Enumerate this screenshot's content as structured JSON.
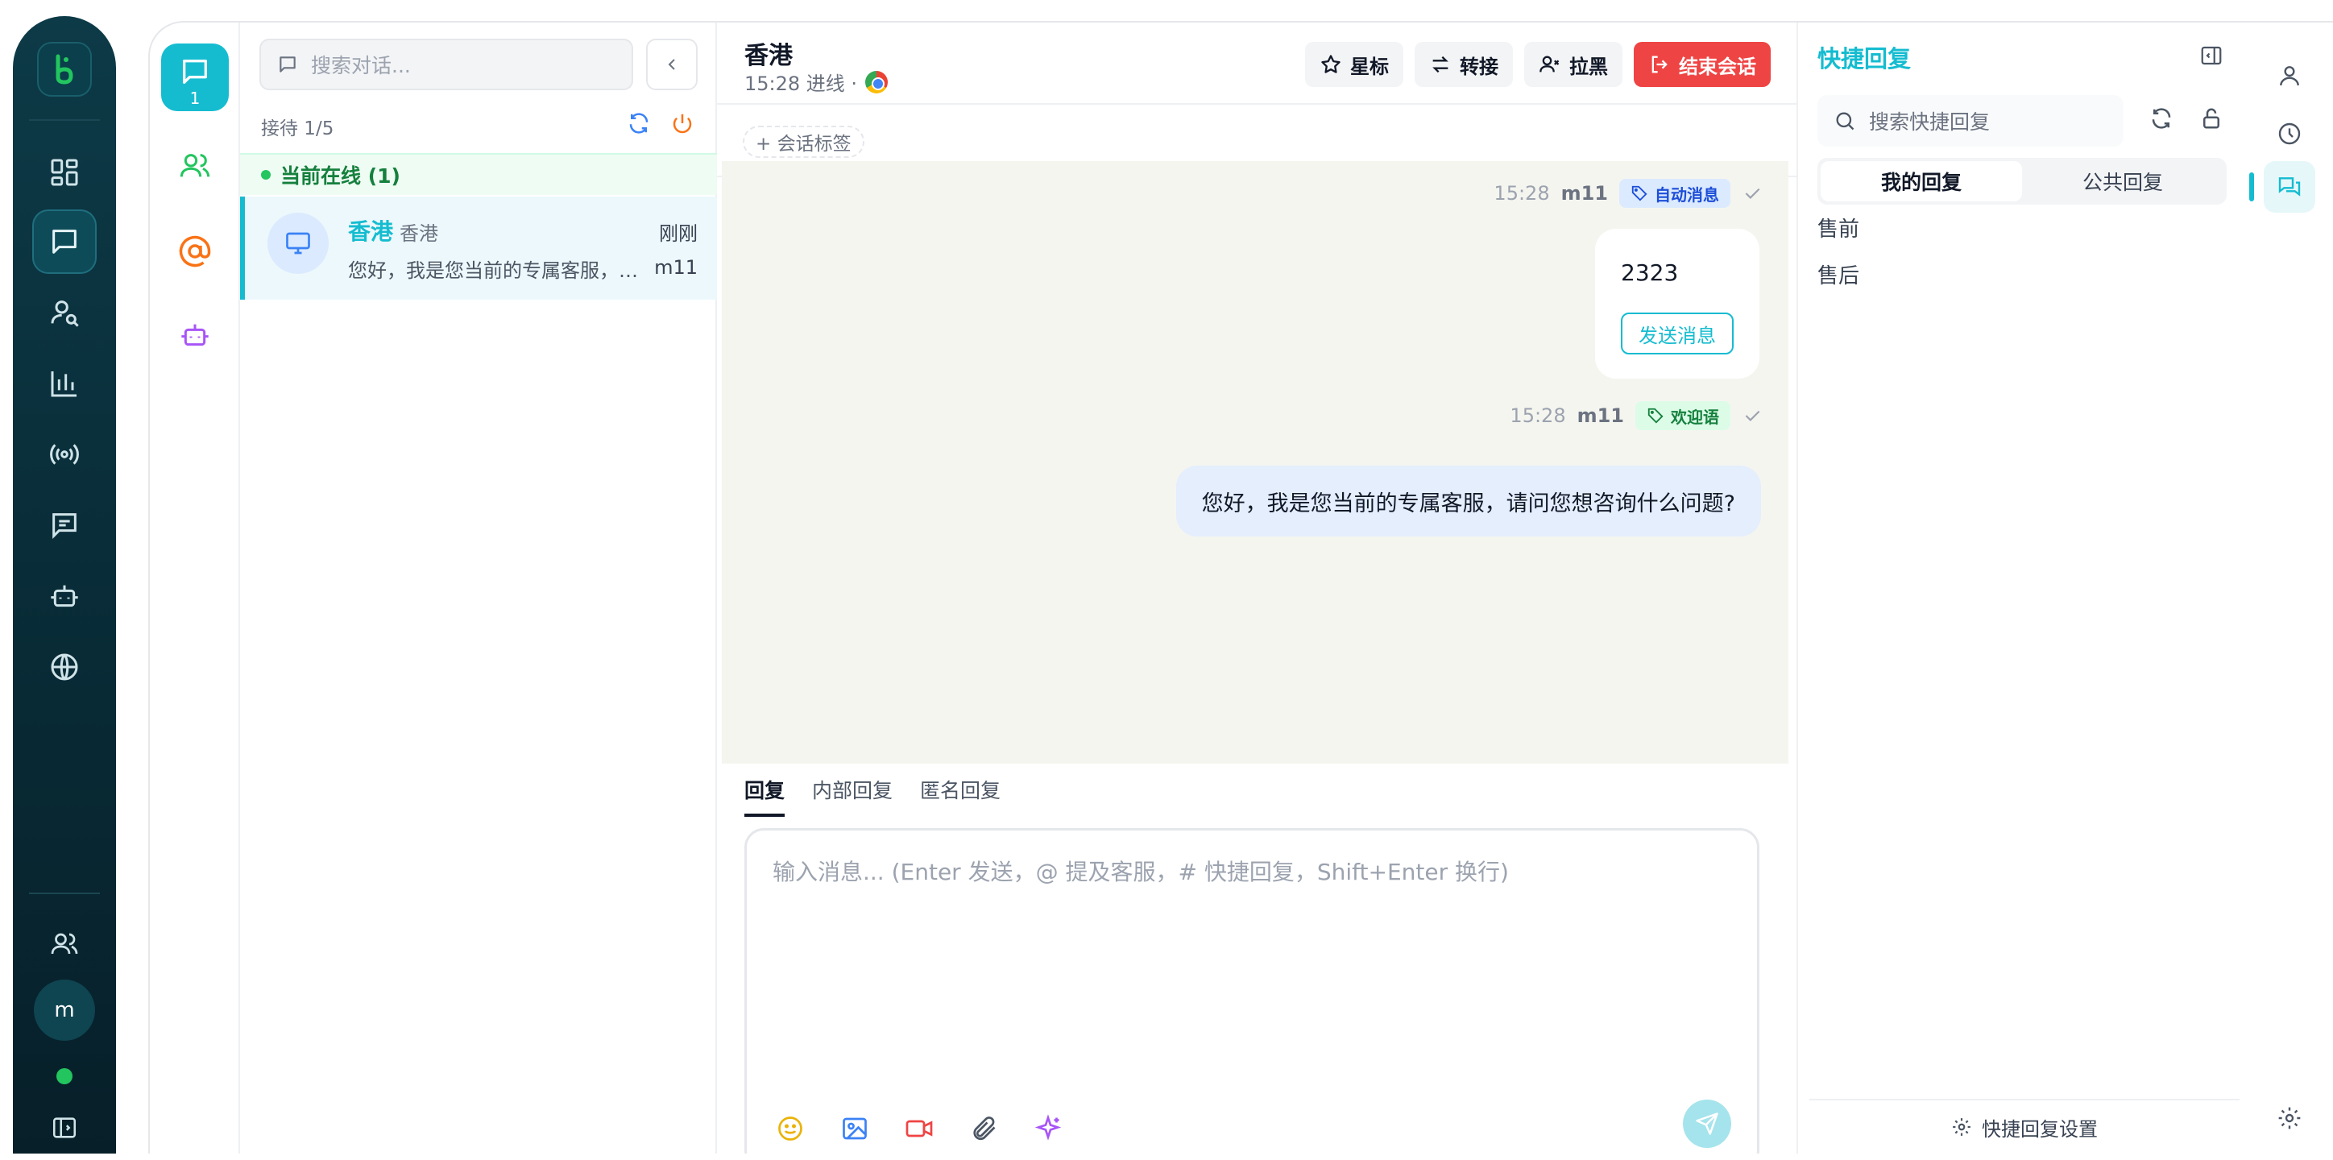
{
  "rail": {
    "items": [
      "dashboard",
      "chat",
      "visitor-search",
      "stats",
      "broadcast",
      "messages",
      "robot",
      "web"
    ],
    "avatar_initial": "m",
    "online_color": "#22c55e"
  },
  "categories": {
    "active_count": "1"
  },
  "convlist": {
    "search_placeholder": "搜索对话...",
    "queue_label": "接待 1/5",
    "online_label": "当前在线 (1)",
    "conversations": [
      {
        "name": "香港",
        "region": "香港",
        "time": "刚刚",
        "preview": "您好，我是您当前的专属客服，请...",
        "agent": "m11"
      }
    ]
  },
  "chat": {
    "title": "香港",
    "subtitle": "15:28 进线 ·",
    "buttons": {
      "star": "星标",
      "transfer": "转接",
      "block": "拉黑",
      "end": "结束会话"
    },
    "tag_add": "+ 会话标签",
    "messages": [
      {
        "time": "15:28",
        "agent": "m11",
        "tag": "自动消息",
        "content": "2323",
        "action": "发送消息"
      },
      {
        "time": "15:28",
        "agent": "m11",
        "tag": "欢迎语",
        "content": "您好，我是您当前的专属客服，请问您想咨询什么问题?"
      }
    ],
    "reply_tabs": [
      "回复",
      "内部回复",
      "匿名回复"
    ],
    "composer_placeholder": "输入消息... (Enter 发送，@ 提及客服，# 快捷回复，Shift+Enter 换行)"
  },
  "quick_reply": {
    "title": "快捷回复",
    "search_placeholder": "搜索快捷回复",
    "tabs": [
      "我的回复",
      "公共回复"
    ],
    "categories": [
      "售前",
      "售后"
    ],
    "settings": "快捷回复设置"
  },
  "colors": {
    "accent": "#15bcd0",
    "danger": "#ef4444",
    "rail_bg": "#082a35"
  }
}
